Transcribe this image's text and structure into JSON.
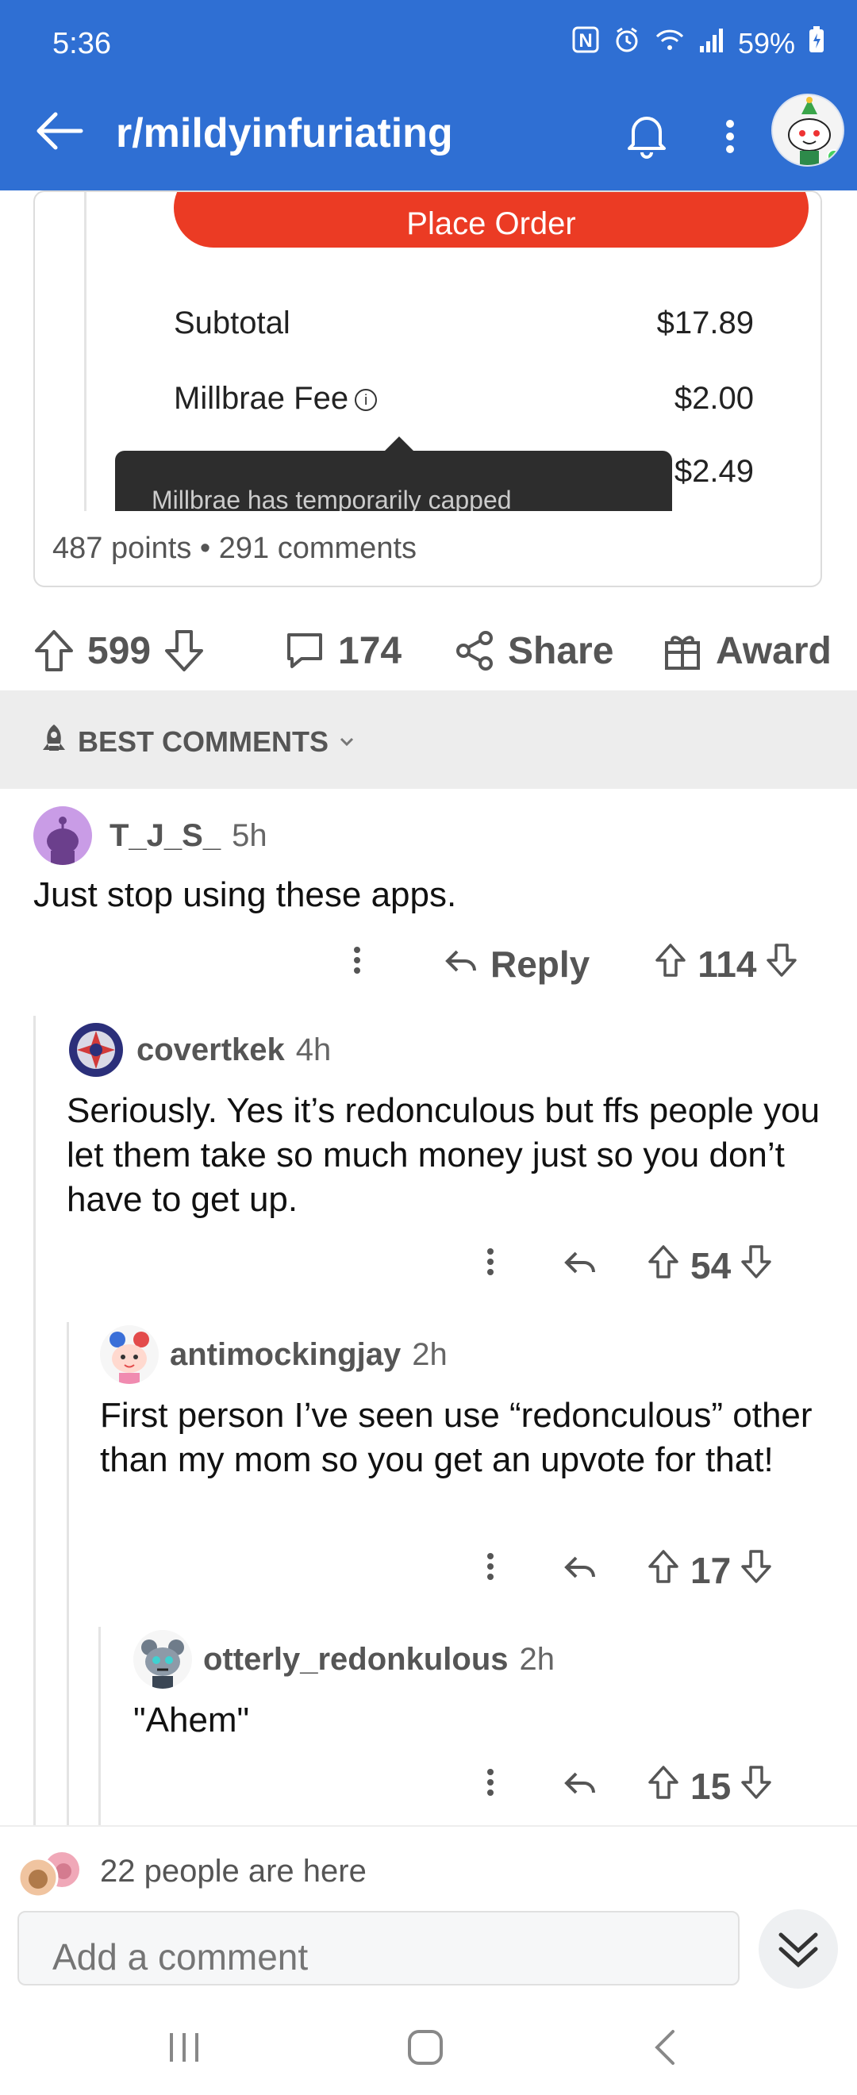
{
  "status_bar": {
    "time": "5:36",
    "battery": "59%"
  },
  "header": {
    "subreddit": "r/mildyinfuriating",
    "icons": [
      "back-arrow-icon",
      "bell-icon",
      "more-vert-icon",
      "avatar"
    ]
  },
  "post_image": {
    "button": "Place Order",
    "lines": [
      {
        "label": "Subtotal",
        "value": "$17.89"
      },
      {
        "label": "Millbrae Fee",
        "value": "$2.00"
      },
      {
        "label": "",
        "value": "$2.49"
      }
    ],
    "tooltip": "Millbrae has temporarily capped",
    "meta": "487 points • 291 comments"
  },
  "actions": {
    "upvotes": "599",
    "comments": "174",
    "share": "Share",
    "award": "Award"
  },
  "sort": {
    "label": "BEST COMMENTS"
  },
  "comments": [
    {
      "user": "T_J_S_",
      "time": "5h",
      "body": "Just stop using these apps.",
      "reply_label": "Reply",
      "score": "114"
    },
    {
      "user": "covertkek",
      "time": "4h",
      "body": "Seriously. Yes it’s redonculous but ffs people you let them take so much money just so you don’t have to get up.",
      "score": "54"
    },
    {
      "user": "antimockingjay",
      "time": "2h",
      "body": "First person I’ve seen use “redonculous” other than my mom so you get an upvote for that!",
      "score": "17"
    },
    {
      "user": "otterly_redonkulous",
      "time": "2h",
      "body": "\"Ahem\"",
      "score": "15"
    }
  ],
  "presence": {
    "text": "22 people are here"
  },
  "composer": {
    "placeholder": "Add a comment"
  },
  "colors": {
    "header_blue": "#2f6fd3",
    "place_order_red": "#eb3b24",
    "meta_gray": "#555555"
  }
}
